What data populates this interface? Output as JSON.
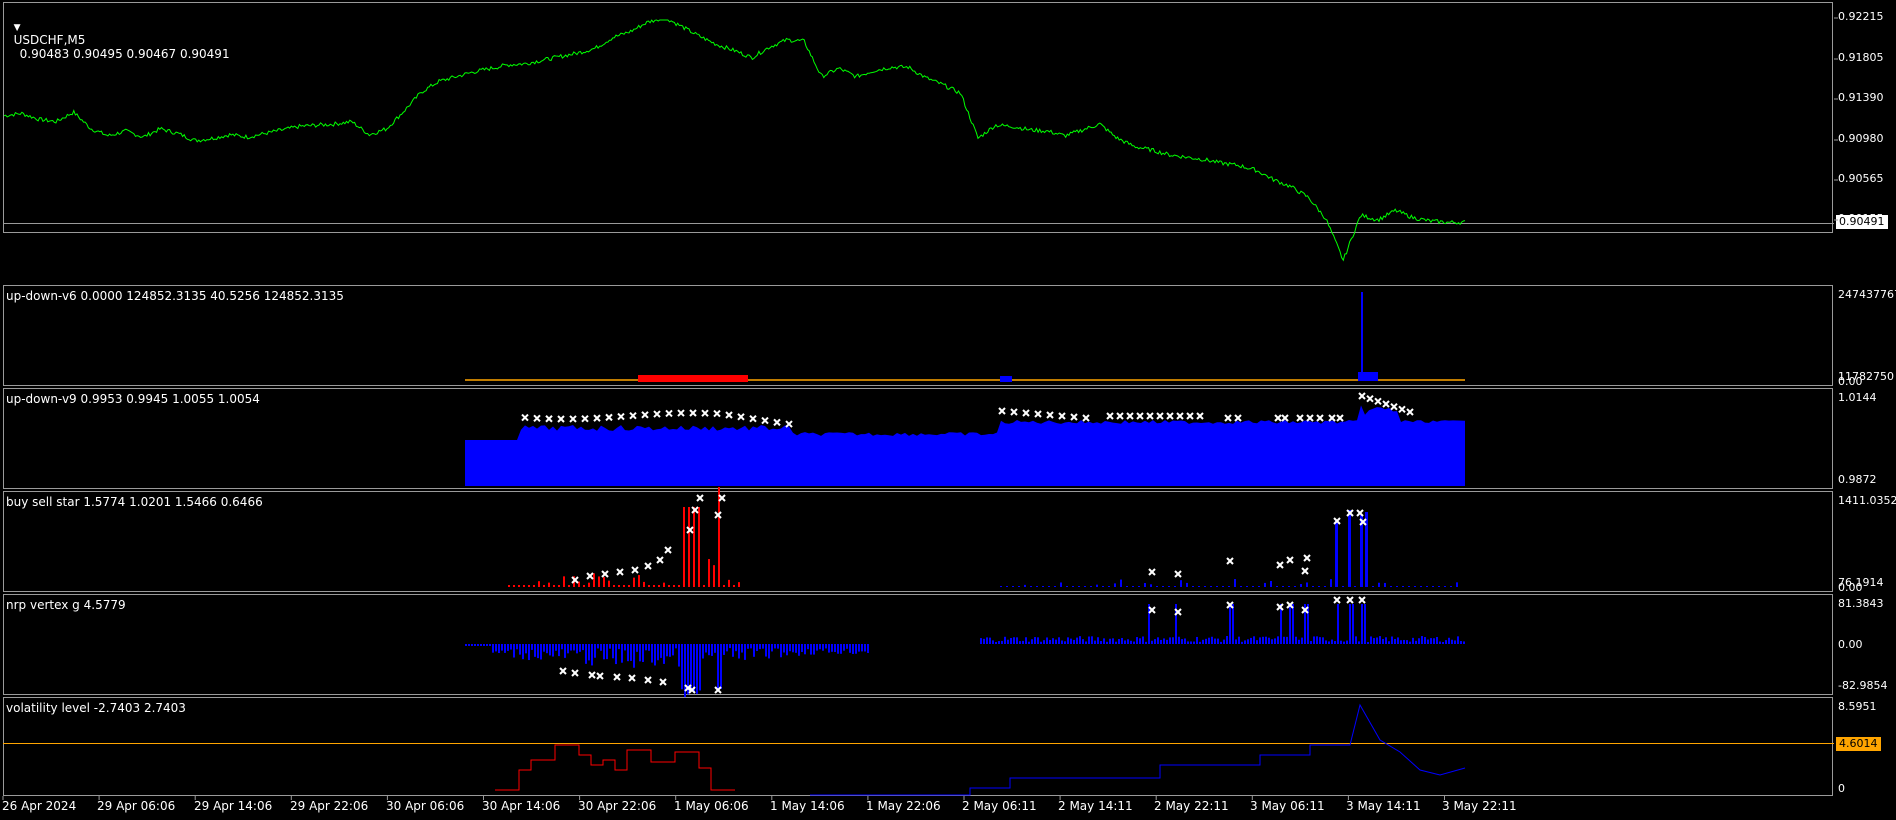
{
  "chart": {
    "symbol_label": "USDCHF,M5",
    "ohlc": "0.90483 0.90495 0.90467 0.90491",
    "current_price": "0.90491",
    "price_scale": [
      "0.92215",
      "0.91805",
      "0.91390",
      "0.90980",
      "0.90565",
      "0.90155"
    ],
    "colors": {
      "price_line": "#00ff00",
      "buy": "#0000ff",
      "sell": "#ff0000",
      "level": "#ffa500",
      "marker": "#ffffff",
      "grid": "#9a9a9a"
    }
  },
  "indicators": [
    {
      "title": "up-down-v6 0.0000 124852.3135 40.5256 124852.3135",
      "scale": [
        "247437767",
        "11782750",
        "0.00"
      ]
    },
    {
      "title": "up-down-v9 0.9953 0.9945 1.0055 1.0054",
      "scale": [
        "1.0144",
        "0.9872"
      ]
    },
    {
      "title": "buy sell star 1.5774 1.0201 1.5466 0.6466",
      "scale": [
        "1411.0352",
        "76.1914",
        "0.00"
      ]
    },
    {
      "title": "nrp vertex g 4.5779",
      "scale": [
        "81.3843",
        "0.00",
        "-82.9854"
      ]
    },
    {
      "title": "volatility level -2.7403 2.7403",
      "scale": [
        "8.5951",
        "4.6014",
        "0"
      ],
      "level_value": "4.6014"
    }
  ],
  "time_axis": [
    "26 Apr 2024",
    "29 Apr 06:06",
    "29 Apr 14:06",
    "29 Apr 22:06",
    "30 Apr 06:06",
    "30 Apr 14:06",
    "30 Apr 22:06",
    "1 May 06:06",
    "1 May 14:06",
    "1 May 22:06",
    "2 May 06:11",
    "2 May 14:11",
    "2 May 22:11",
    "3 May 06:11",
    "3 May 14:11",
    "3 May 22:11"
  ],
  "price_series": [
    0.9139,
    0.9141,
    0.9136,
    0.9134,
    0.9142,
    0.9128,
    0.9122,
    0.9126,
    0.9121,
    0.9128,
    0.9124,
    0.9118,
    0.912,
    0.9123,
    0.9121,
    0.9124,
    0.9127,
    0.913,
    0.9131,
    0.9132,
    0.9134,
    0.9123,
    0.9128,
    0.9143,
    0.9159,
    0.9168,
    0.9172,
    0.9176,
    0.9179,
    0.9182,
    0.9183,
    0.9186,
    0.9189,
    0.9192,
    0.9196,
    0.9205,
    0.921,
    0.9218,
    0.9222,
    0.9214,
    0.9206,
    0.9199,
    0.9194,
    0.9188,
    0.9197,
    0.9203,
    0.9202,
    0.9172,
    0.9179,
    0.9172,
    0.9177,
    0.918,
    0.918,
    0.9171,
    0.9165,
    0.9158,
    0.912,
    0.9131,
    0.913,
    0.9127,
    0.9126,
    0.9122,
    0.9127,
    0.9132,
    0.912,
    0.9113,
    0.911,
    0.9106,
    0.9104,
    0.9102,
    0.9099,
    0.9097,
    0.9093,
    0.9085,
    0.9079,
    0.907,
    0.9052,
    0.9017,
    0.9055,
    0.9051,
    0.9059,
    0.9053,
    0.905,
    0.9049,
    0.9049
  ]
}
